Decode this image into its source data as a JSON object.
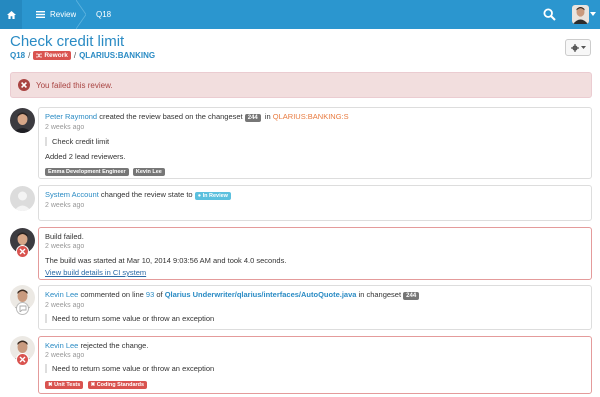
{
  "nav": {
    "reviews_label": "Reviews",
    "q18_label": "Q18"
  },
  "header": {
    "title": "Check credit limit",
    "review_id": "Q18",
    "sep1": "/",
    "rework_label": "Rework",
    "sep2": "/",
    "project": "QLARIUS:BANKING"
  },
  "alert": {
    "text": "You failed this review."
  },
  "feed": [
    {
      "user": "Peter Raymond",
      "action": "created the review based on the changeset",
      "changeset": "244",
      "in": "in",
      "repo": "QLARIUS:BANKING:S",
      "time": "2 weeks ago",
      "quote": "Check credit limit",
      "note": "Added 2 lead reviewers.",
      "tags": [
        "Emma Development Engineer",
        "Kevin Lee"
      ]
    },
    {
      "user": "System Account",
      "action": "changed the review state to",
      "state": "In Review",
      "time": "2 weeks ago"
    },
    {
      "line1": "Build failed.",
      "time": "2 weeks ago",
      "detail": "The build was started at Mar 10, 2014 9:03:56 AM and took 4.0 seconds.",
      "link": "View build details in CI system"
    },
    {
      "user": "Kevin Lee",
      "action": "commented on line",
      "line_no": "93",
      "of": "of",
      "file": "Qlarius Underwriter/qlarius/interfaces/AutoQuote.java",
      "in_changeset": "in changeset",
      "changeset": "244",
      "time": "2 weeks ago",
      "quote": "Need to return some value or throw an exception"
    },
    {
      "user": "Kevin Lee",
      "action": "rejected the change.",
      "time": "2 weeks ago",
      "quote": "Need to return some value or throw an exception",
      "tags": [
        "Unit Tests",
        "Coding Standards"
      ]
    }
  ],
  "colors": {
    "nav": "#2b96cf",
    "link": "#2a8bc4",
    "danger": "#d9534f",
    "info": "#5bc0de"
  }
}
